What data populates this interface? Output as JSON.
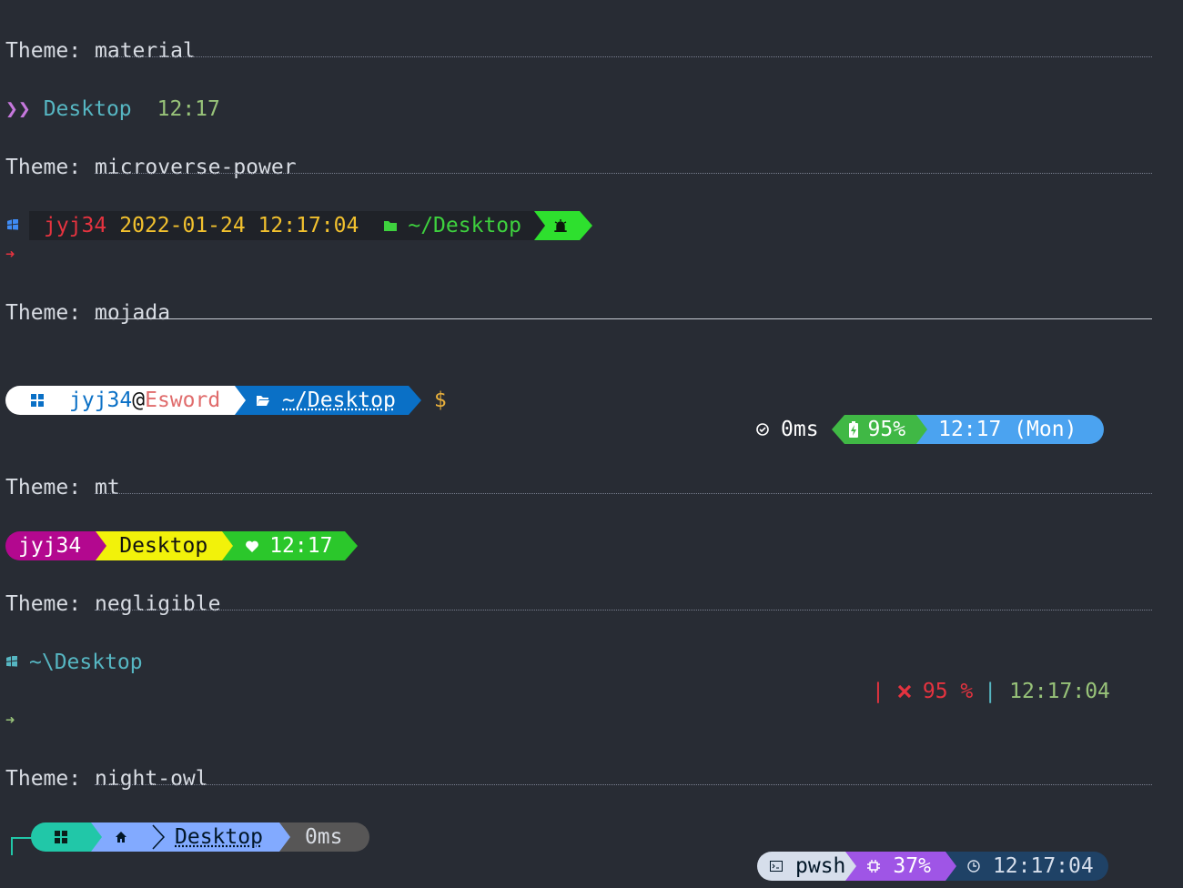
{
  "themes": [
    {
      "label": "Theme:",
      "name": "material"
    },
    {
      "label": "Theme:",
      "name": "microverse-power"
    },
    {
      "label": "Theme:",
      "name": "mojada"
    },
    {
      "label": "Theme:",
      "name": "mt"
    },
    {
      "label": "Theme:",
      "name": "negligible"
    },
    {
      "label": "Theme:",
      "name": "night-owl"
    }
  ],
  "material": {
    "prompt_symbol": "❯❯",
    "dir": "Desktop",
    "time": "12:17"
  },
  "microverse": {
    "user": "jyj34",
    "datetime": "2022-01-24 12:17:04",
    "path": "~/Desktop",
    "arrow": "➜"
  },
  "mojada": {
    "user": "jyj34",
    "at": "@",
    "host": "Esword",
    "path": "~/Desktop",
    "dollar": "$",
    "exec_time": "0ms",
    "battery": "95%",
    "time": "12:17 (Mon)"
  },
  "mt": {
    "user": "jyj34",
    "dir": "Desktop",
    "time": "12:17"
  },
  "negligible": {
    "path": "~\\Desktop",
    "sep1": "|",
    "battery": "95 %",
    "sep2": "|",
    "time": "12:17:04",
    "arrow": "➜"
  },
  "nightowl": {
    "dir": "Desktop",
    "exec_time": "0ms",
    "shell": "pwsh",
    "cpu": "37%",
    "time": "12:17:04"
  },
  "colors": {
    "background": "#282c34",
    "material_symbol": "#c678dd",
    "material_dir": "#56b6c2",
    "material_time": "#98c379",
    "micro_user": "#e5333f",
    "micro_date": "#f2c12e",
    "micro_path": "#3ed13e",
    "mojada_blue": "#0a70c6",
    "mt_magenta": "#b3088f",
    "mt_yellow": "#f2f20a",
    "mt_green": "#2bc72b",
    "nightowl_teal": "#21c7a8",
    "nightowl_blue": "#82aaff",
    "nightowl_purple": "#9f55e6"
  }
}
